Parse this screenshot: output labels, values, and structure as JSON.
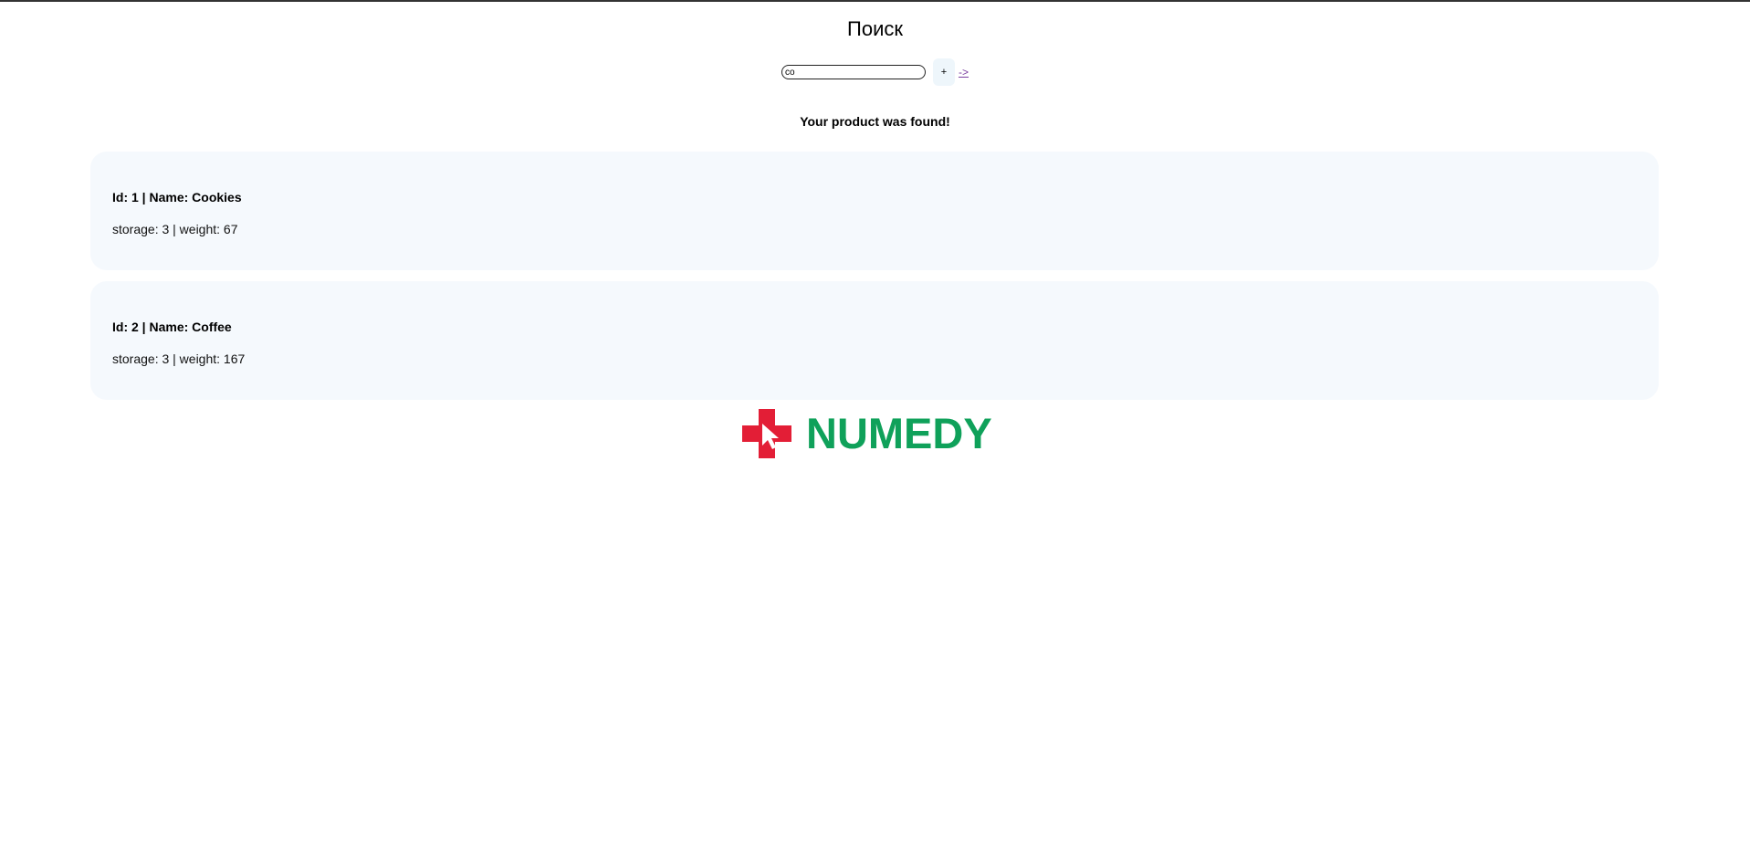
{
  "page": {
    "title": "Поиск"
  },
  "search": {
    "value": "co",
    "add_label": "+",
    "next_label": "->"
  },
  "status": {
    "message": "Your product was found!"
  },
  "results": [
    {
      "title": "Id: 1 | Name: Cookies",
      "details": "storage: 3 | weight: 67"
    },
    {
      "title": "Id: 2 | Name: Coffee",
      "details": "storage: 3 | weight: 167"
    }
  ],
  "logo": {
    "text": "NUMEDY",
    "icon": "red-cross-cursor-icon",
    "cross_color": "#e31e36",
    "text_color": "#0fa15a"
  }
}
